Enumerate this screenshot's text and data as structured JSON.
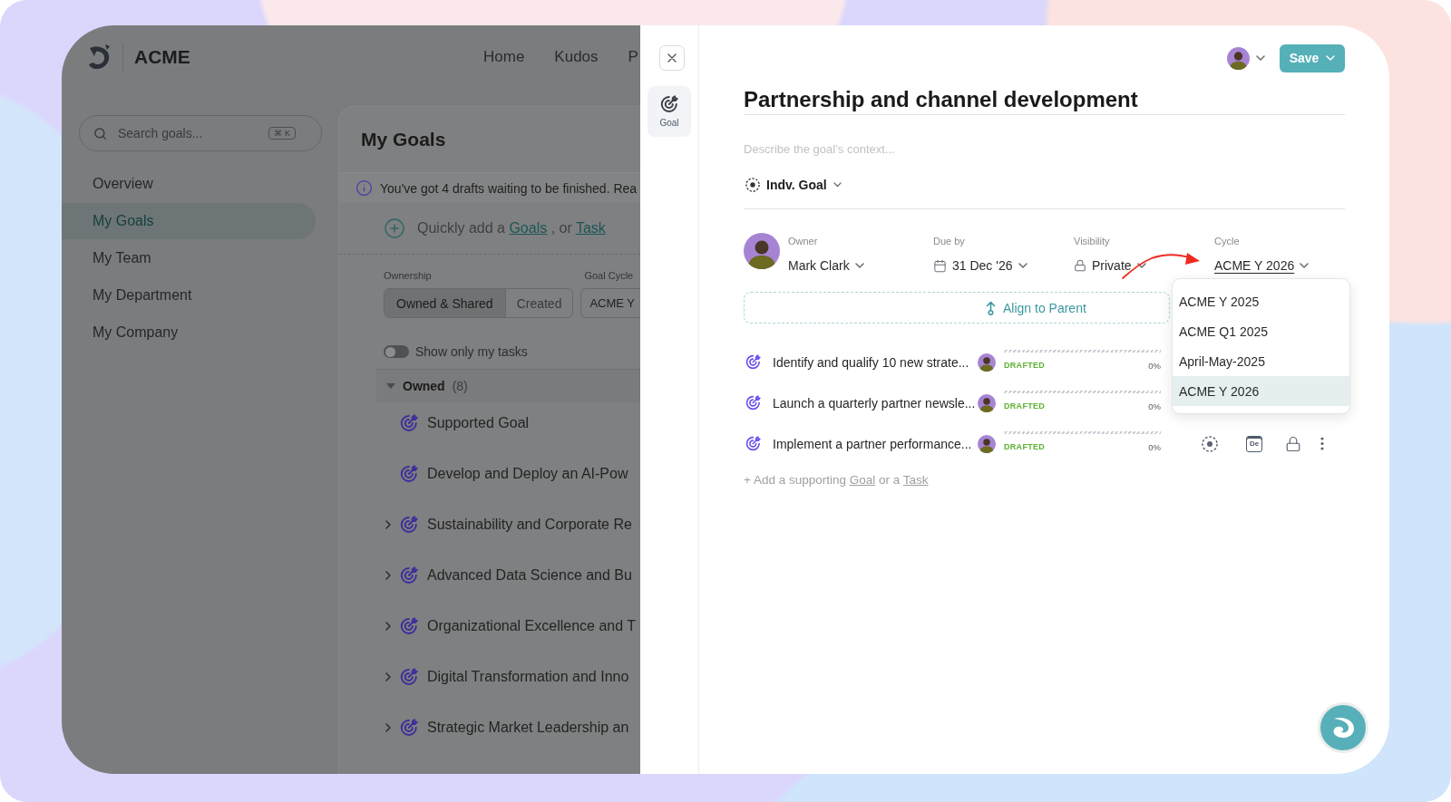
{
  "app": {
    "brand": "ACME",
    "nav": [
      {
        "label": "Home"
      },
      {
        "label": "Kudos"
      },
      {
        "label": "P"
      }
    ]
  },
  "sidebar": {
    "search": {
      "placeholder": "Search goals...",
      "shortcut": "⌘ K"
    },
    "items": [
      {
        "label": "Overview",
        "selected": false
      },
      {
        "label": "My Goals",
        "selected": true
      },
      {
        "label": "My Team",
        "selected": false
      },
      {
        "label": "My Department",
        "selected": false
      },
      {
        "label": "My Company",
        "selected": false
      }
    ]
  },
  "main": {
    "title": "My Goals",
    "info_banner": "You've got 4 drafts waiting to be finished. Rea",
    "quick_add": {
      "text": "Quickly add a",
      "goal_link": "Goals",
      "separator": ", or",
      "task_link": "Task"
    },
    "ownership": {
      "label": "Ownership",
      "options": [
        {
          "label": "Owned & Shared",
          "selected": true
        },
        {
          "label": "Created",
          "selected": false
        }
      ]
    },
    "goal_cycle": {
      "label": "Goal Cycle",
      "value": "ACME Y"
    },
    "my_tasks_toggle": {
      "label": "Show only my tasks",
      "on": false
    },
    "group": {
      "label": "Owned",
      "count": "(8)",
      "expanded": true,
      "goals": [
        {
          "title": "Supported Goal",
          "expandable": false
        },
        {
          "title": "Develop and Deploy an AI-Pow",
          "expandable": false
        },
        {
          "title": "Sustainability and Corporate Re",
          "expandable": true
        },
        {
          "title": "Advanced Data Science and Bu",
          "expandable": true
        },
        {
          "title": "Organizational Excellence and T",
          "expandable": true
        },
        {
          "title": "Digital Transformation and Inno",
          "expandable": true
        },
        {
          "title": "Strategic Market Leadership an",
          "expandable": true
        }
      ]
    }
  },
  "drawer": {
    "tabs": [
      {
        "label": "Goal",
        "selected": true
      }
    ],
    "save_button": "Save",
    "title": "Partnership and channel development",
    "description_placeholder": "Describe the goal’s context...",
    "goal_type": "Indv. Goal",
    "fields": [
      {
        "kind": "owner",
        "label": "Owner",
        "value": "Mark Clark"
      },
      {
        "kind": "due_date",
        "label": "Due by",
        "value": "31 Dec '26"
      },
      {
        "kind": "visibility",
        "label": "Visibility",
        "value": "Private"
      },
      {
        "kind": "cycle",
        "label": "Cycle",
        "value": "ACME Y 2026",
        "expanded": true,
        "options": [
          {
            "label": "ACME Y 2025",
            "selected": false
          },
          {
            "label": "ACME Q1 2025",
            "selected": false
          },
          {
            "label": "April-May-2025",
            "selected": false
          },
          {
            "label": "ACME Y 2026",
            "selected": true
          }
        ]
      }
    ],
    "align_button": "Align to Parent",
    "supporting_goals": [
      {
        "title": "Identify and qualify 10 new strate...",
        "status": "DRAFTED",
        "progress": "0%"
      },
      {
        "title": "Launch a quarterly partner newsle...",
        "status": "DRAFTED",
        "progress": "0%"
      },
      {
        "title": "Implement a partner performance...",
        "status": "DRAFTED",
        "progress": "0%",
        "actions": [
          {
            "kind": "goal_type"
          },
          {
            "kind": "due_date",
            "label": "De"
          },
          {
            "kind": "visibility"
          },
          {
            "kind": "menu"
          }
        ]
      }
    ],
    "add_supporting": {
      "text": "+ Add a supporting",
      "goal_link": "Goal",
      "separator": "or a",
      "task_link": "Task"
    }
  }
}
